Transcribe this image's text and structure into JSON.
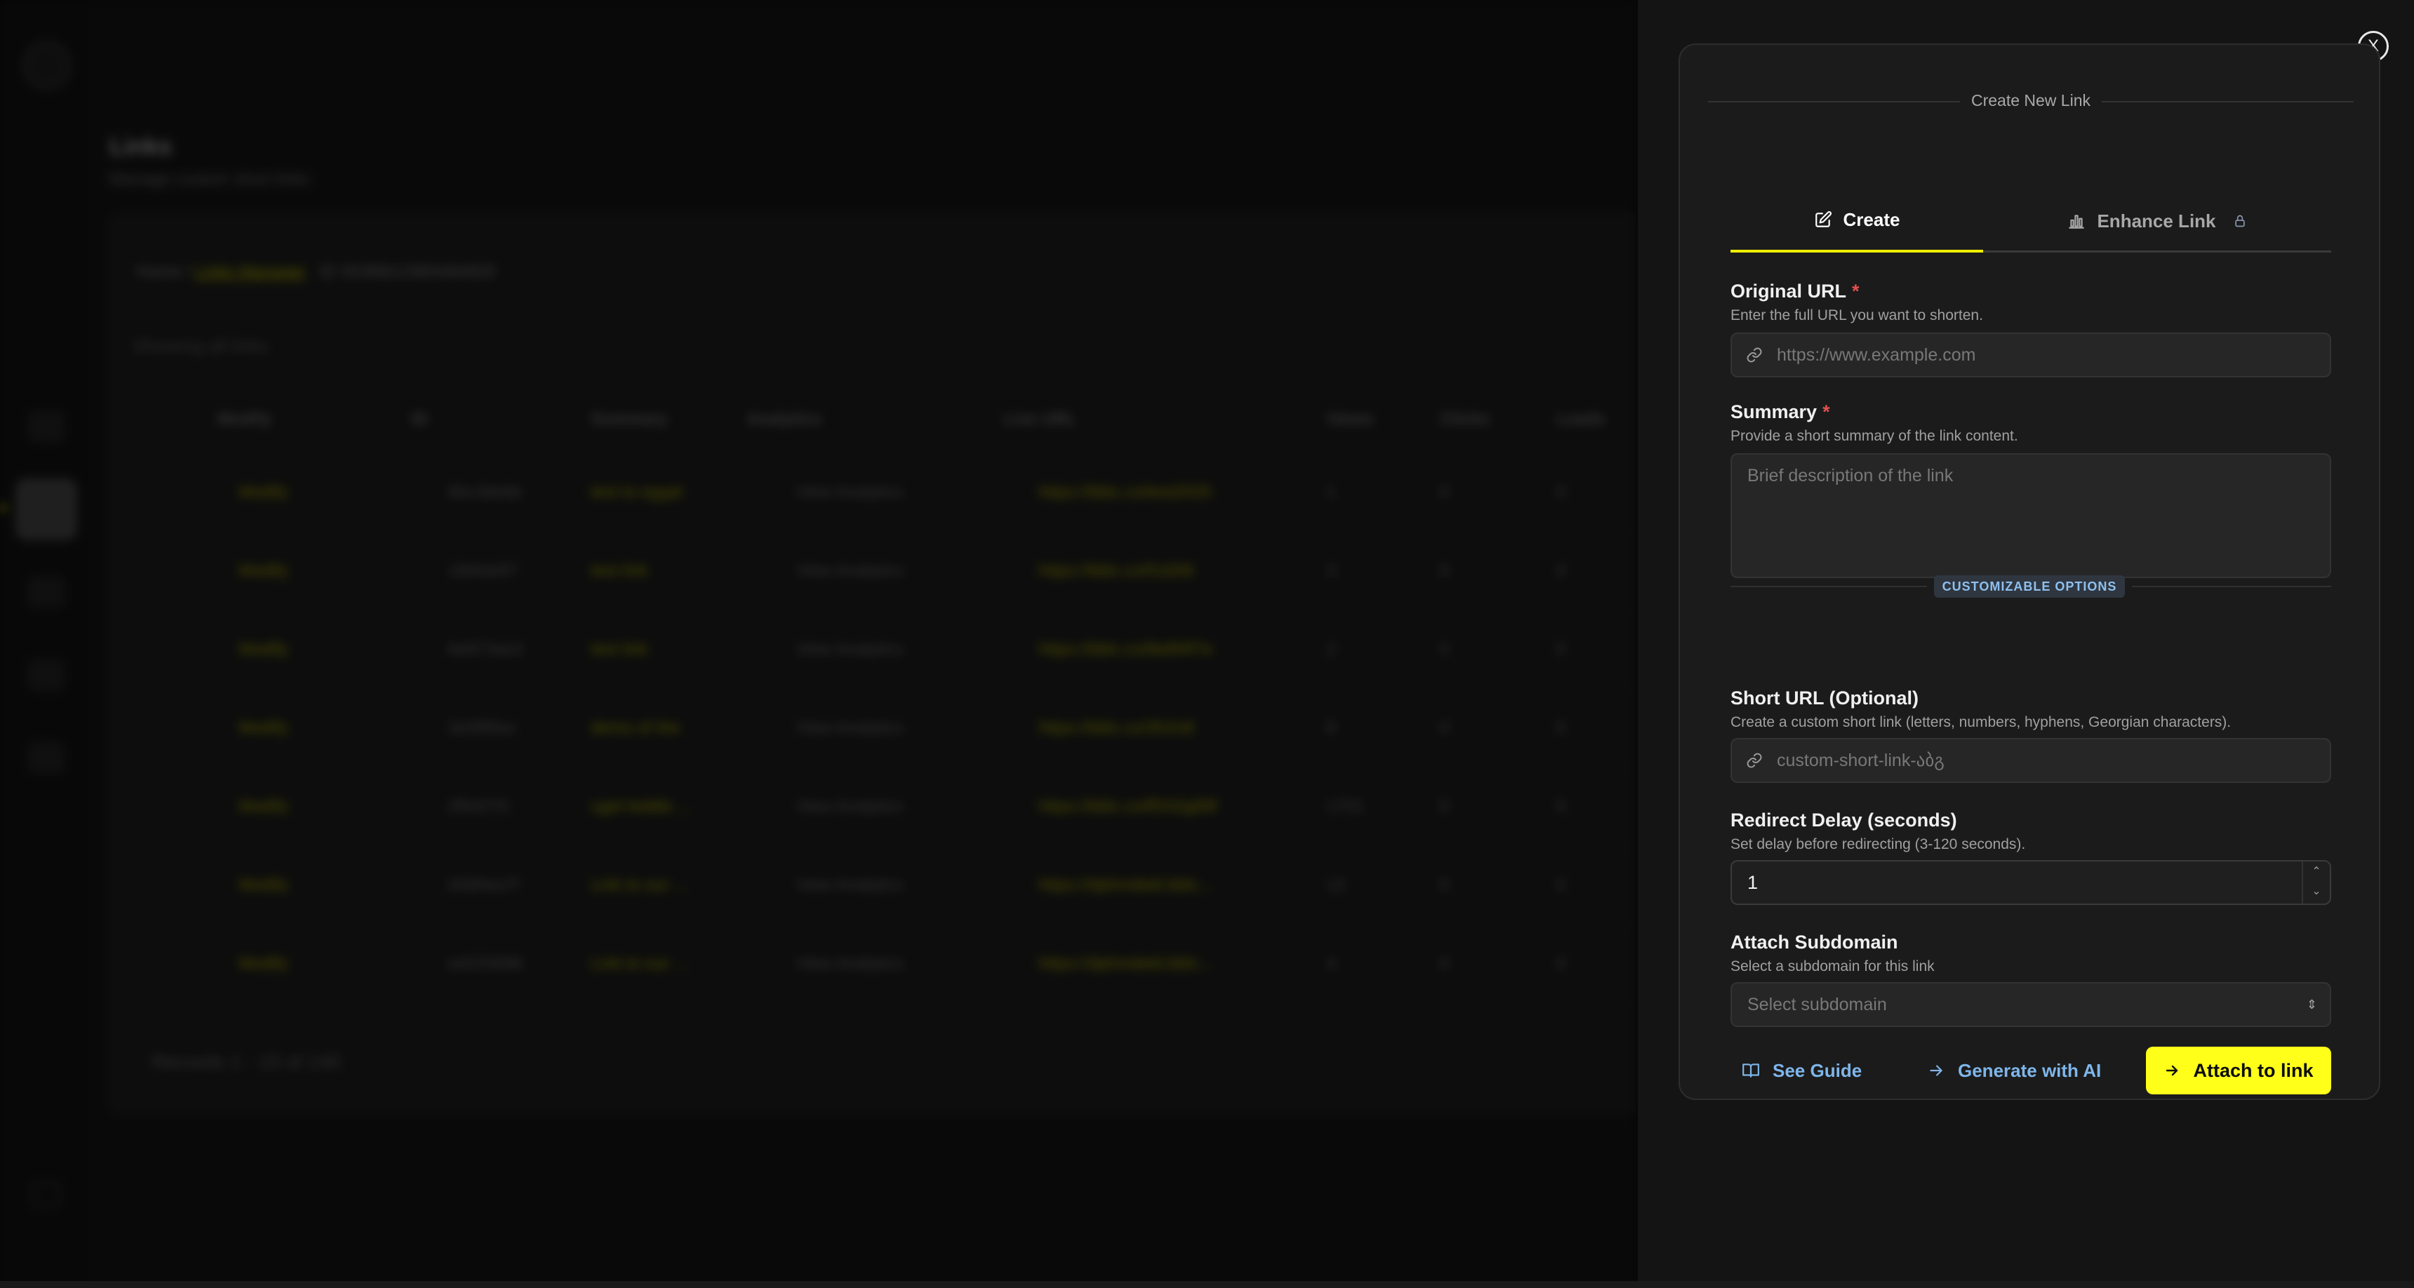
{
  "background": {
    "page_title": "Links",
    "page_subtitle": "Manage custom short links",
    "breadcrumb": {
      "home": "Home",
      "current": "Links Manager",
      "id": "ID 553f6b12983484820"
    },
    "showing": "Showing all links",
    "columns": [
      "Modify",
      "ID",
      "Summary",
      "Analytics",
      "Live URL",
      "Views",
      "Clicks",
      "Leads"
    ],
    "rows": [
      {
        "modify": "Modify",
        "id": "6bc3de6b",
        "summary": "test to egypt",
        "analytics": "View Analytics",
        "url": "https://bblc.co/test2025",
        "views": "1",
        "clicks": "0",
        "leads": "0"
      },
      {
        "modify": "Modify",
        "id": "18d4a0f7",
        "summary": "test link",
        "analytics": "View Analytics",
        "url": "https://bblc.co/f1d2t6",
        "views": "3",
        "clicks": "0",
        "leads": "0"
      },
      {
        "modify": "Modify",
        "id": "6e873ae3",
        "summary": "test link",
        "analytics": "View Analytics",
        "url": "https://bblc.co/8e8f4f7e",
        "views": "2",
        "clicks": "0",
        "leads": "0"
      },
      {
        "modify": "Modify",
        "id": "3e5f80ec",
        "summary": "demo of the",
        "analytics": "View Analytics",
        "url": "https://bblc.co/3h2n8",
        "views": "8",
        "clicks": "0",
        "leads": "0"
      },
      {
        "modify": "Modify",
        "id": "2f0427b",
        "summary": "ugel leddle ...",
        "analytics": "View Analytics",
        "url": "https://bblc.co/ff242g89f",
        "views": "1701",
        "clicks": "0",
        "leads": "0"
      },
      {
        "modify": "Modify",
        "id": "d3d0ea7f",
        "summary": "Link to our ...",
        "analytics": "View Analytics",
        "url": "https://dphmdedi.bblc...",
        "views": "13",
        "clicks": "0",
        "leads": "0"
      },
      {
        "modify": "Modify",
        "id": "a4225696",
        "summary": "Link to our ...",
        "analytics": "View Analytics",
        "url": "https://dphmdedi.bblc...",
        "views": "4",
        "clicks": "0",
        "leads": "0"
      }
    ],
    "records": "Records 1 - 15 of 140"
  },
  "drawer": {
    "close_label": "X",
    "legend": "Create New Link",
    "tabs": [
      {
        "label": "Create",
        "icon": "edit-icon",
        "active": true
      },
      {
        "label": "Enhance Link",
        "icon": "chart-icon",
        "locked": true
      }
    ],
    "original_url": {
      "label": "Original URL",
      "required": "*",
      "hint": "Enter the full URL you want to shorten.",
      "placeholder": "https://www.example.com"
    },
    "summary": {
      "label": "Summary",
      "required": "*",
      "hint": "Provide a short summary of the link content.",
      "placeholder": "Brief description of the link"
    },
    "section_label": "CUSTOMIZABLE OPTIONS",
    "short_url": {
      "label": "Short URL (Optional)",
      "hint": "Create a custom short link (letters, numbers, hyphens, Georgian characters).",
      "placeholder": "custom-short-link-აბგ"
    },
    "redirect_delay": {
      "label": "Redirect Delay (seconds)",
      "hint": "Set delay before redirecting (3-120 seconds).",
      "value": "1"
    },
    "subdomain": {
      "label": "Attach Subdomain",
      "hint": "Select a subdomain for this link",
      "placeholder": "Select subdomain"
    },
    "actions": {
      "guide": "See Guide",
      "generate": "Generate with AI",
      "attach": "Attach to link"
    },
    "colors": {
      "accent": "#ffff1a",
      "link": "#7fb6ea",
      "required": "#e25050"
    }
  }
}
